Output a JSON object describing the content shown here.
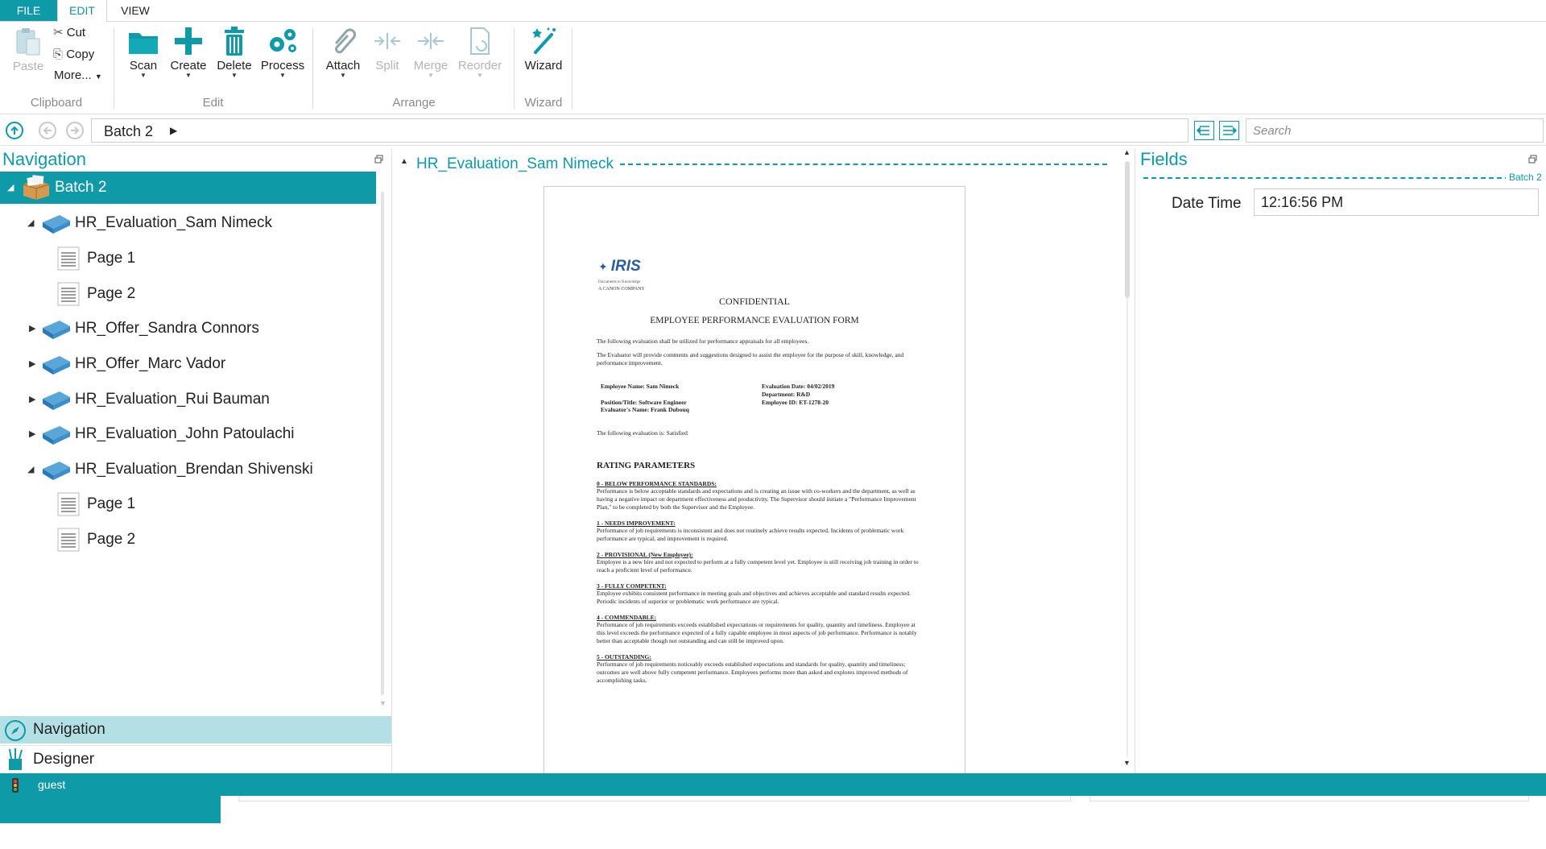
{
  "ribbon": {
    "tabs": [
      "FILE",
      "EDIT",
      "VIEW"
    ],
    "clipboard": {
      "paste": "Paste",
      "cut": "Cut",
      "copy": "Copy",
      "more": "More...",
      "group": "Clipboard"
    },
    "edit": {
      "scan": "Scan",
      "create": "Create",
      "delete": "Delete",
      "process": "Process",
      "group": "Edit"
    },
    "arrange": {
      "attach": "Attach",
      "split": "Split",
      "merge": "Merge",
      "reorder": "Reorder",
      "group": "Arrange"
    },
    "wizard": {
      "wizard": "Wizard",
      "group": "Wizard"
    }
  },
  "breadcrumb": {
    "current": "Batch 2"
  },
  "search": {
    "placeholder": "Search"
  },
  "navigation": {
    "title": "Navigation",
    "tree": [
      {
        "label": "Batch 2",
        "kind": "batch",
        "level": 0,
        "expanded": true,
        "selected": true
      },
      {
        "label": "HR_Evaluation_Sam Nimeck",
        "kind": "document",
        "level": 1,
        "expanded": true
      },
      {
        "label": "Page 1",
        "kind": "page",
        "level": 2
      },
      {
        "label": "Page 2",
        "kind": "page",
        "level": 2
      },
      {
        "label": "HR_Offer_Sandra Connors",
        "kind": "document",
        "level": 1,
        "expanded": false
      },
      {
        "label": "HR_Offer_Marc Vador",
        "kind": "document",
        "level": 1,
        "expanded": false
      },
      {
        "label": "HR_Evaluation_Rui Bauman",
        "kind": "document",
        "level": 1,
        "expanded": false
      },
      {
        "label": "HR_Evaluation_John Patoulachi",
        "kind": "document",
        "level": 1,
        "expanded": false
      },
      {
        "label": "HR_Evaluation_Brendan Shivenski",
        "kind": "document",
        "level": 1,
        "expanded": true
      },
      {
        "label": "Page 1",
        "kind": "page",
        "level": 2
      },
      {
        "label": "Page 2",
        "kind": "page",
        "level": 2
      }
    ],
    "bottom_tabs": [
      "Navigation",
      "Designer"
    ]
  },
  "viewer": {
    "title": "HR_Evaluation_Sam Nimeck",
    "document": {
      "logo": "IRIS",
      "logo_tagline": "Documents to Knowledge",
      "logo_company": "A CANON COMPANY",
      "heading1": "CONFIDENTIAL",
      "heading2": "EMPLOYEE PERFORMANCE EVALUATION FORM",
      "intro1": "The following evaluation shall be utilized for performance appraisals for all employees.",
      "intro2": "The Evaluator will provide comments and suggestions designed to assist the employee for the purpose of skill, knowledge, and performance improvement.",
      "employee_name": "Employee Name: Sam Nimeck",
      "position": "Position/Title: Software Engineer",
      "evaluator": "Evaluator's Name: Frank Dubouq",
      "eval_date": "Evaluation Date: 04/02/2019",
      "department": "Department: R&D",
      "employee_id": "Employee ID: ET-1278-20",
      "result": "The following evaluation is: Satisfied",
      "rating_title": "RATING PARAMETERS",
      "ratings": [
        {
          "head": "0 - BELOW PERFORMANCE STANDARDS:",
          "text": "Performance is below acceptable standards and expectations and is creating an issue with co-workers and the department, as well as having a negative impact on department effectiveness and productivity. The Supervisor should initiate a \"Performance Improvement Plan,\" to be completed by both the Supervisor and the Employee."
        },
        {
          "head": "1 - NEEDS IMPROVEMENT:",
          "text": "Performance of job requirements is inconsistent and does not routinely achieve results expected. Incidents of problematic work performance are typical, and improvement is required."
        },
        {
          "head": "2 - PROVISIONAL (New Employee):",
          "text": "Employee is a new hire and not expected to perform at a fully competent level yet. Employee is still receiving job training in order to reach a proficient level of performance."
        },
        {
          "head": "3 - FULLY COMPETENT:",
          "text": "Employee exhibits consistent performance in meeting goals and objectives and achieves acceptable and standard results expected. Periodic incidents of superior or problematic work performance are typical."
        },
        {
          "head": "4 - COMMENDABLE:",
          "text": "Performance of job requirements exceeds established expectations or requirements for quality, quantity and timeliness. Employee at this level exceeds the performance expected of a fully capable employee in most aspects of job performance. Performance is notably better than acceptable though not outstanding and can still be improved upon."
        },
        {
          "head": "5 - OUTSTANDING:",
          "text": "Performance of job requirements noticeably exceeds established expectations and standards for quality, quantity and timeliness; outcomes are well above fully competent performance. Employees performs more than asked and explores improved methods of accomplishing tasks."
        }
      ]
    }
  },
  "fields": {
    "title": "Fields",
    "group_label": "Batch 2",
    "items": [
      {
        "label": "Date Time",
        "value": "12:16:56 PM"
      }
    ]
  },
  "status": {
    "user": "guest"
  },
  "colors": {
    "accent": "#0e9aa7",
    "selected_tab_bg": "#b3e0e5"
  }
}
